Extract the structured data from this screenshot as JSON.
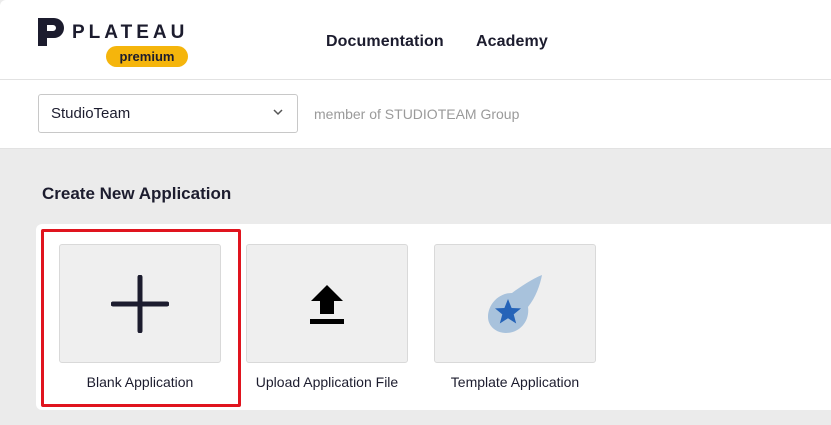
{
  "header": {
    "brand_name": "PLATEAU",
    "brand_badge": "premium",
    "nav": [
      {
        "label": "Documentation"
      },
      {
        "label": "Academy"
      }
    ]
  },
  "team": {
    "selected": "StudioTeam",
    "membership": "member of STUDIOTEAM Group"
  },
  "create": {
    "title": "Create New Application",
    "options": [
      {
        "label": "Blank Application",
        "icon": "plus-icon",
        "highlighted": true
      },
      {
        "label": "Upload Application File",
        "icon": "upload-icon"
      },
      {
        "label": "Template Application",
        "icon": "star-comet-icon"
      }
    ]
  },
  "colors": {
    "brand_dark": "#1c1c2e",
    "badge": "#f5b50c",
    "highlight_border": "#e0141e",
    "template_icon_light": "#a8c2dc",
    "template_icon_star": "#2563b8"
  }
}
